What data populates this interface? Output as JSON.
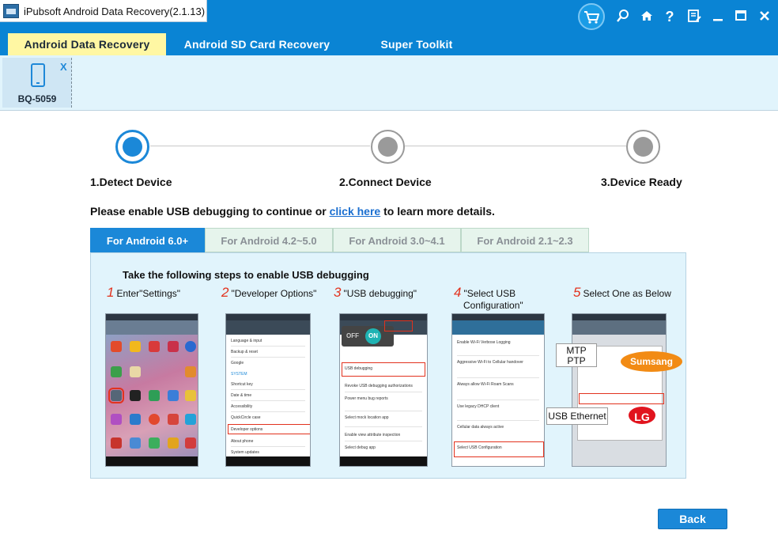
{
  "window": {
    "title": "iPubsoft Android Data Recovery(2.1.13)"
  },
  "tabs": [
    {
      "label": "Android Data Recovery"
    },
    {
      "label": "Android SD Card Recovery"
    },
    {
      "label": "Super Toolkit"
    }
  ],
  "device": {
    "name": "BQ-5059",
    "close_label": "X"
  },
  "steps": [
    {
      "label": "1.Detect Device"
    },
    {
      "label": "2.Connect Device"
    },
    {
      "label": "3.Device Ready"
    }
  ],
  "instruction": {
    "before": "Please enable USB debugging to continue or ",
    "link": "click here",
    "after": " to learn more details."
  },
  "version_tabs": [
    {
      "label": "For Android 6.0+"
    },
    {
      "label": "For Android 4.2~5.0"
    },
    {
      "label": "For Android 3.0~4.1"
    },
    {
      "label": "For Android 2.1~2.3"
    }
  ],
  "panel": {
    "title": "Take the following steps to enable USB debugging",
    "substeps": [
      {
        "num": "1",
        "text": "Enter\"Settings\""
      },
      {
        "num": "2",
        "text": "\"Developer Options\""
      },
      {
        "num": "3",
        "text": "\"USB debugging\""
      },
      {
        "num": "4",
        "text": "\"Select USB",
        "text2": "Configuration\""
      },
      {
        "num": "5",
        "text": "Select One as Below"
      }
    ],
    "screen2_items": [
      "Language & input",
      "Backup & reset",
      "Google",
      "SYSTEM",
      "Shortcut key",
      "Date & time",
      "Accessibility",
      "QuickCircle case",
      "Developer options",
      "About phone",
      "System updates"
    ],
    "screen3_items": [
      "USB debugging",
      "Revoke USB debugging authorizations",
      "Power menu bug reports",
      "Select mock location app",
      "Enable view attribute inspection",
      "Select debug app"
    ],
    "screen4_items": [
      "Enable Wi-Fi Verbose Logging",
      "Aggressive Wi-Fi to Cellular handover",
      "Always allow Wi-Fi Roam Scans",
      "Use legacy DHCP client",
      "Cellular data always active",
      "Select USB Configuration"
    ],
    "toggle": {
      "off": "OFF",
      "on": "ON"
    },
    "tags": {
      "mtp": "MTP",
      "ptp": "PTP",
      "usb_ethernet": "USB Ethernet",
      "samsung": "Sumsang",
      "lg": "LG"
    }
  },
  "buttons": {
    "back": "Back"
  },
  "colors": {
    "primary_blue": "#0a84d4",
    "active_tab": "#fff7a3",
    "panel_bg": "#e1f4fc",
    "step_red": "#e2321e",
    "samsung_orange": "#f28b14",
    "lg_red": "#e1141e"
  }
}
